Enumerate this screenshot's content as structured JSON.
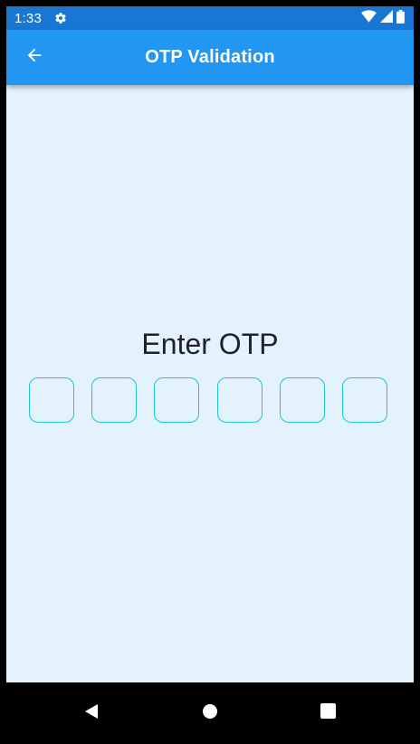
{
  "status_bar": {
    "time": "1:33",
    "icons": [
      "gear-icon",
      "wifi-icon",
      "signal-icon",
      "battery-icon"
    ]
  },
  "app_bar": {
    "title": "OTP Validation",
    "back_icon": "arrow-left-icon"
  },
  "main": {
    "heading": "Enter OTP",
    "otp_digits": [
      "",
      "",
      "",
      "",
      "",
      ""
    ]
  },
  "nav_bar": {
    "icons": [
      "back-triangle-icon",
      "home-circle-icon",
      "recents-square-icon"
    ]
  },
  "colors": {
    "status_bar": "#1976d2",
    "app_bar": "#2196f3",
    "background": "#e3f2fd",
    "otp_border": "#1ec3d6",
    "text": "#1f2329"
  }
}
